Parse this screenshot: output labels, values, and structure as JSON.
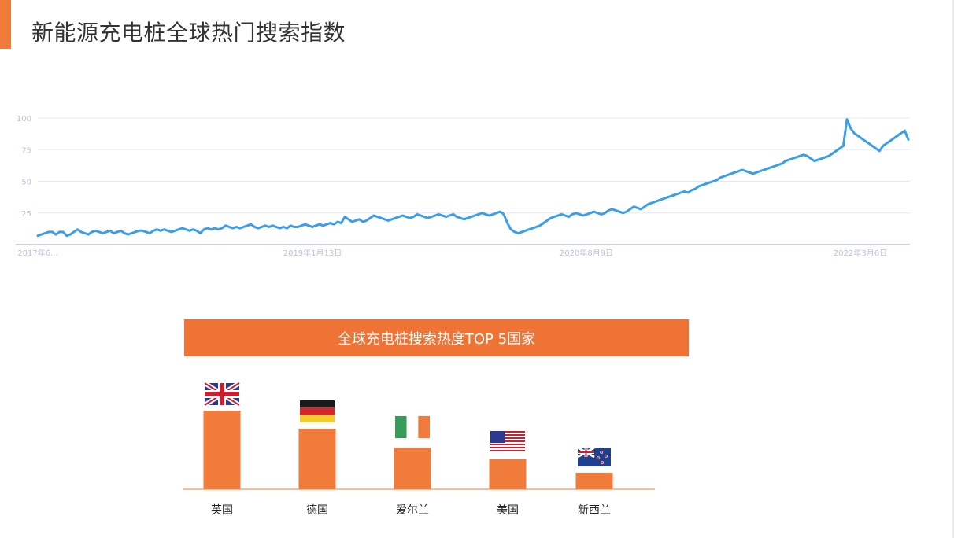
{
  "title": "新能源充电桩全球热门搜索指数",
  "colors": {
    "accent": "#f07b3a",
    "line": "#3d9ee8",
    "bar": "#f07b3a",
    "grid": "#e4e8f2",
    "tick": "#b9c2da"
  },
  "chart_data": [
    {
      "type": "line",
      "title": "",
      "xlabel": "",
      "ylabel": "",
      "ylim": [
        0,
        100
      ],
      "yticks": [
        "25",
        "50",
        "75",
        "100"
      ],
      "xtick_labels": [
        "2017年6...",
        "2019年1月13日",
        "2020年8月9日",
        "2022年3月6日"
      ],
      "x_range": [
        "2017-06",
        "2022-06"
      ],
      "grid": true,
      "series": [
        {
          "values": [
            7,
            8,
            9,
            10,
            10,
            8,
            10,
            10,
            7,
            8,
            10,
            12,
            10,
            9,
            8,
            10,
            11,
            10,
            9,
            10,
            11,
            9,
            10,
            11,
            9,
            8,
            9,
            10,
            11,
            11,
            10,
            9,
            11,
            12,
            11,
            12,
            11,
            10,
            11,
            12,
            13,
            12,
            11,
            12,
            11,
            9,
            12,
            13,
            12,
            13,
            12,
            13,
            15,
            14,
            13,
            14,
            13,
            14,
            15,
            16,
            14,
            13,
            14,
            15,
            14,
            15,
            14,
            13,
            14,
            13,
            15,
            14,
            14,
            15,
            16,
            15,
            14,
            15,
            16,
            15,
            16,
            17,
            16,
            18,
            17,
            22,
            20,
            18,
            19,
            20,
            18,
            19,
            21,
            23,
            22,
            21,
            20,
            19,
            20,
            21,
            22,
            23,
            22,
            21,
            22,
            24,
            23,
            22,
            21,
            22,
            23,
            24,
            23,
            22,
            23,
            24,
            22,
            21,
            20,
            21,
            22,
            23,
            24,
            25,
            24,
            23,
            24,
            25,
            26,
            24,
            17,
            12,
            10,
            9,
            10,
            11,
            12,
            13,
            14,
            15,
            17,
            19,
            21,
            22,
            23,
            24,
            23,
            22,
            24,
            25,
            24,
            23,
            24,
            25,
            26,
            25,
            24,
            25,
            27,
            28,
            27,
            26,
            25,
            26,
            28,
            30,
            29,
            28,
            30,
            32,
            33,
            34,
            35,
            36,
            37,
            38,
            39,
            40,
            41,
            42,
            41,
            43,
            44,
            46,
            47,
            48,
            49,
            50,
            51,
            53,
            54,
            55,
            56,
            57,
            58,
            59,
            58,
            57,
            56,
            57,
            58,
            59,
            60,
            61,
            62,
            63,
            64,
            66,
            67,
            68,
            69,
            70,
            71,
            70,
            68,
            66,
            67,
            68,
            69,
            70,
            72,
            74,
            76,
            78,
            99,
            92,
            88,
            86,
            84,
            82,
            80,
            78,
            76,
            74,
            78,
            80,
            82,
            84,
            86,
            88,
            90,
            83
          ]
        }
      ]
    },
    {
      "type": "bar",
      "title": "全球充电桩搜索热度TOP 5国家",
      "categories": [
        "英国",
        "德国",
        "爱尔兰",
        "美国",
        "新西兰"
      ],
      "values": [
        100,
        77,
        53,
        38,
        21
      ],
      "flags": [
        "uk-flag-icon",
        "germany-flag-icon",
        "ireland-flag-icon",
        "usa-flag-icon",
        "new-zealand-flag-icon"
      ]
    }
  ]
}
